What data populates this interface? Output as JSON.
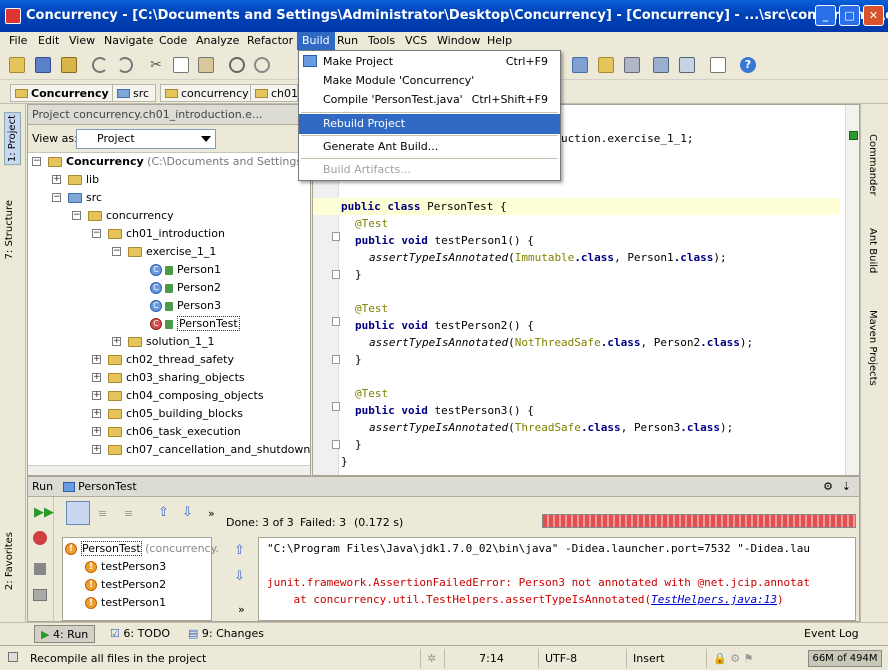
{
  "window": {
    "title": "Concurrency - [C:\\Documents and Settings\\Administrator\\Desktop\\Concurrency] - [Concurrency] - ...\\src\\concurrency\\ch01..."
  },
  "menubar": [
    "File",
    "Edit",
    "View",
    "Navigate",
    "Code",
    "Analyze",
    "Refactor",
    "Build",
    "Run",
    "Tools",
    "VCS",
    "Window",
    "Help"
  ],
  "build_menu": {
    "items": [
      {
        "label": "Make Project",
        "shortcut": "Ctrl+F9"
      },
      {
        "label": "Make Module 'Concurrency'",
        "shortcut": ""
      },
      {
        "label": "Compile 'PersonTest.java'",
        "shortcut": "Ctrl+Shift+F9"
      },
      {
        "label": "Rebuild Project",
        "shortcut": ""
      },
      {
        "label": "Generate Ant Build...",
        "shortcut": ""
      },
      {
        "label": "Build Artifacts...",
        "shortcut": ""
      }
    ]
  },
  "breadcrumbs": [
    "Concurrency",
    "src",
    "concurrency",
    "ch01_"
  ],
  "project_panel": {
    "header": "Project concurrency.ch01_introduction.e...",
    "view_as_label": "View as:",
    "view_as_value": "Project",
    "tree": [
      {
        "label": "Concurrency",
        "suffix": "(C:\\Documents and Settings\\Admi"
      },
      {
        "label": "lib"
      },
      {
        "label": "src"
      },
      {
        "label": "concurrency"
      },
      {
        "label": "ch01_introduction"
      },
      {
        "label": "exercise_1_1"
      },
      {
        "label": "Person1"
      },
      {
        "label": "Person2"
      },
      {
        "label": "Person3"
      },
      {
        "label": "PersonTest"
      },
      {
        "label": "solution_1_1"
      },
      {
        "label": "ch02_thread_safety"
      },
      {
        "label": "ch03_sharing_objects"
      },
      {
        "label": "ch04_composing_objects"
      },
      {
        "label": "ch05_building_blocks"
      },
      {
        "label": "ch06_task_execution"
      },
      {
        "label": "ch07_cancellation_and_shutdown"
      }
    ]
  },
  "editor": {
    "lines": {
      "pkg": "uction.exercise_1_1;",
      "class_kw": "public class",
      "class_name": " PersonTest {",
      "test_ann": "@Test",
      "pub_void": "public void",
      "m1": " testPerson1() {",
      "m2": " testPerson2() {",
      "m3": " testPerson3() {",
      "assert_fn": "assertTypeIsAnnotated",
      "a1_ann": "Immutable",
      "a2_ann": "NotThreadSafe",
      "a3_ann": "ThreadSafe",
      "dot_class": ".class",
      "p1": "Person1",
      "p2": "Person2",
      "p3": "Person3",
      "open": "(",
      "comma": ", ",
      "close": ");",
      "brace": "}"
    }
  },
  "run_panel": {
    "title": "Run",
    "config": "PersonTest",
    "done": "Done: 3 of 3",
    "failed": "Failed: 3",
    "time": "(0.172 s)",
    "tests": [
      {
        "label": "PersonTest",
        "suffix": "(concurrency."
      },
      {
        "label": "testPerson3"
      },
      {
        "label": "testPerson2"
      },
      {
        "label": "testPerson1"
      }
    ],
    "console": {
      "line1": "\"C:\\Program Files\\Java\\jdk1.7.0_02\\bin\\java\" -Didea.launcher.port=7532 \"-Didea.lau",
      "line2": "junit.framework.AssertionFailedError: Person3 not annotated with @net.jcip.annotat",
      "line3_prefix": "    at concurrency.util.TestHelpers.assertTypeIsAnnotated(",
      "line3_link": "TestHelpers.java:13",
      "line3_suffix": ")"
    }
  },
  "left_tabs": [
    "1: Project",
    "7: Structure",
    "2: Favorites"
  ],
  "right_tabs": [
    "Commander",
    "Ant Build",
    "Maven Projects"
  ],
  "bottom_tabs": [
    {
      "label": "4: Run"
    },
    {
      "label": "6: TODO"
    },
    {
      "label": "9: Changes"
    }
  ],
  "event_log": "Event Log",
  "status": {
    "message": "Recompile all files in the project",
    "position": "7:14",
    "encoding": "UTF-8",
    "mode": "Insert",
    "memory": "66M of 494M"
  },
  "colors": {
    "accent": "#316ac5",
    "error": "#cc0000",
    "keyword": "#000080",
    "annotation": "#808000"
  }
}
